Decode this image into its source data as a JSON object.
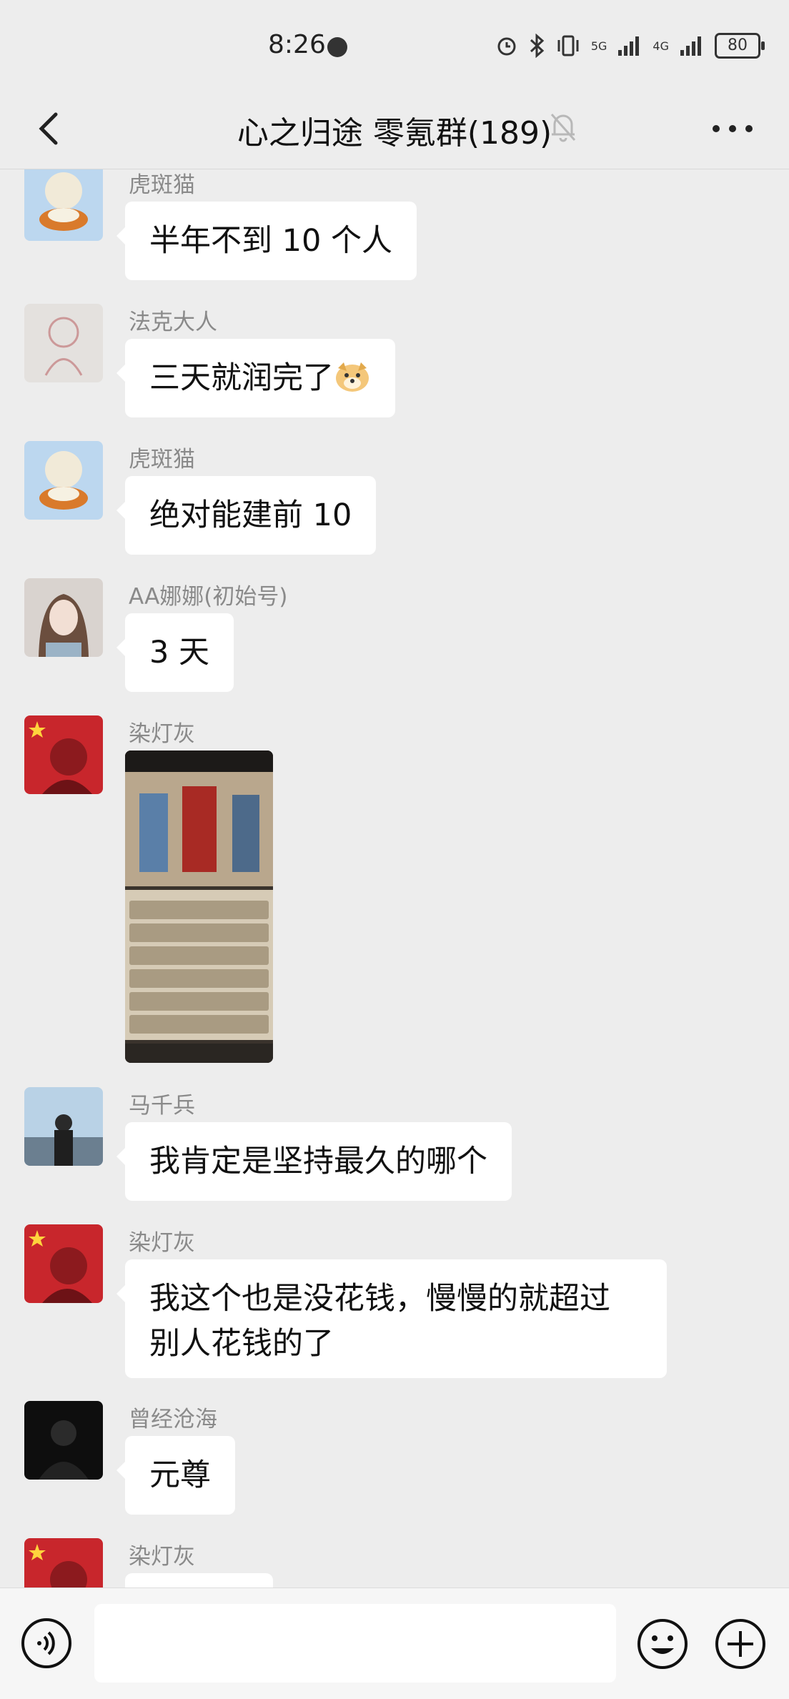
{
  "status_bar": {
    "time": "8:26",
    "battery": "80",
    "network_1": "5G",
    "network_2": "4G"
  },
  "header": {
    "title": "心之归途 零氪群(189)"
  },
  "messages": [
    {
      "sender": "虎斑猫",
      "text": "半年不到 10 个人",
      "avatar": "cat-avatar"
    },
    {
      "sender": "法克大人",
      "text": "三天就润完了",
      "emoji": "doge-emoji",
      "avatar": "sketch-avatar"
    },
    {
      "sender": "虎斑猫",
      "text": "绝对能建前 10",
      "avatar": "cat-avatar"
    },
    {
      "sender": "AA娜娜(初始号)",
      "text": "3 天",
      "avatar": "girl-avatar"
    },
    {
      "sender": "染灯灰",
      "image": "game-ranking-screenshot",
      "avatar": "red-flag-avatar"
    },
    {
      "sender": "马千兵",
      "text": "我肯定是坚持最久的哪个",
      "avatar": "city-avatar"
    },
    {
      "sender": "染灯灰",
      "text_line1": "我这个也是没花钱，慢慢的就超过",
      "text_line2": "别人花钱的了",
      "avatar": "red-flag-avatar"
    },
    {
      "sender": "曾经沧海",
      "text": "元尊",
      "avatar": "dark-avatar"
    },
    {
      "sender": "染灯灰",
      "avatar": "red-flag-avatar"
    }
  ],
  "colors": {
    "background": "#ededed",
    "bubble": "#ffffff",
    "sender": "#8a8a8a",
    "flag_red": "#d8282a"
  }
}
